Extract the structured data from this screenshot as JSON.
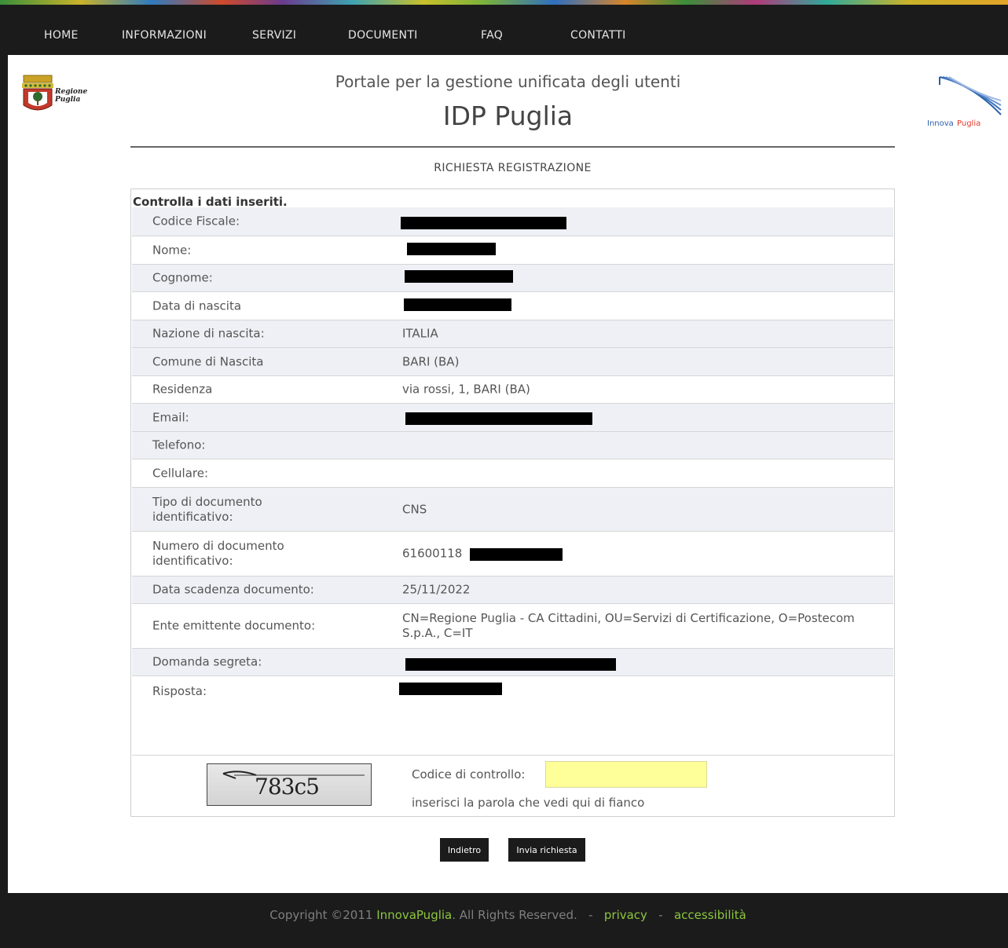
{
  "nav": {
    "items": [
      "HOME",
      "INFORMAZIONI",
      "SERVIZI",
      "DOCUMENTI",
      "FAQ",
      "CONTATTI"
    ]
  },
  "header": {
    "title": "Portale per la gestione unificata degli utenti",
    "subtitle": "IDP Puglia",
    "logo_left_text": "Regione Puglia",
    "logo_right_text": "InnovaPuglia"
  },
  "page": {
    "heading": "RICHIESTA REGISTRAZIONE",
    "form_title": "Controlla i dati inseriti."
  },
  "rows": [
    {
      "label": "Codice Fiscale:",
      "value": ""
    },
    {
      "label": "Nome:",
      "value": ""
    },
    {
      "label": "Cognome:",
      "value": ""
    },
    {
      "label": "Data di nascita",
      "value": ""
    },
    {
      "label": "Nazione di nascita:",
      "value": "ITALIA"
    },
    {
      "label": "Comune di Nascita",
      "value": "BARI (BA)"
    },
    {
      "label": "Residenza",
      "value": "via rossi, 1, BARI (BA)"
    },
    {
      "label": "Email:",
      "value": ""
    },
    {
      "label": "Telefono:",
      "value": ""
    },
    {
      "label": "Cellulare:",
      "value": ""
    },
    {
      "label": "Tipo di documento identificativo:",
      "value": "CNS"
    },
    {
      "label": "Numero di documento identificativo:",
      "value": "61600118"
    },
    {
      "label": "Data scadenza documento:",
      "value": "25/11/2022"
    },
    {
      "label": "Ente emittente documento:",
      "value": "CN=Regione Puglia - CA Cittadini, OU=Servizi di Certificazione, O=Postecom S.p.A., C=IT"
    },
    {
      "label": "Domanda segreta:",
      "value": ""
    },
    {
      "label": "Risposta:",
      "value": ""
    }
  ],
  "captcha": {
    "image_text": "783c5",
    "label": "Codice di controllo:",
    "input_value": "",
    "hint": "inserisci la parola che vedi qui di fianco"
  },
  "buttons": {
    "back": "Indietro",
    "submit": "Invia richiesta"
  },
  "footer": {
    "copyright_prefix": "Copyright ©2011",
    "company": "InnovaPuglia",
    "rights": ". All Rights Reserved.",
    "sep": "-",
    "privacy": "privacy",
    "accessibility": "accessibilità"
  },
  "colors": {
    "nav_bg": "#1b1b1b",
    "row_shade": "#eef0f5",
    "captcha_input_bg": "#ffff99",
    "footer_link": "#8cc63f"
  }
}
